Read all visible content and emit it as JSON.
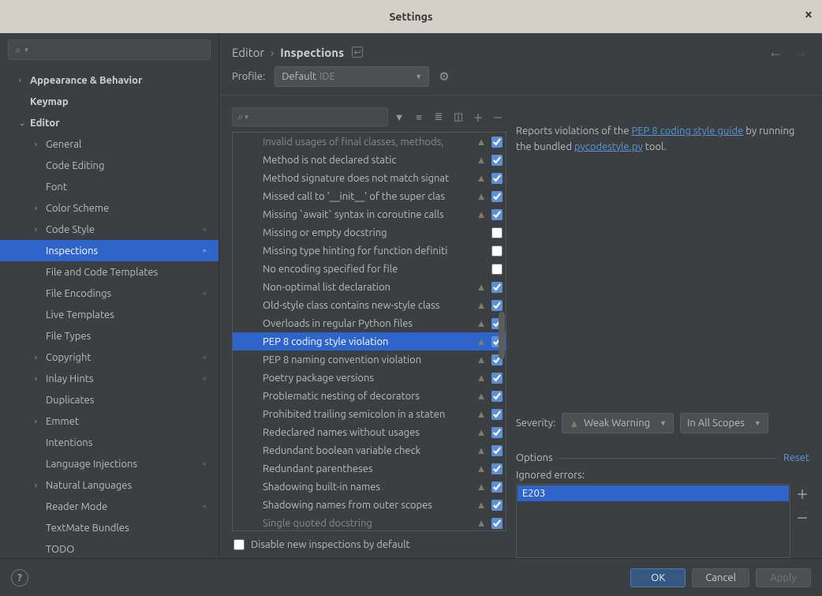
{
  "window": {
    "title": "Settings"
  },
  "breadcrumb": {
    "parent": "Editor",
    "current": "Inspections"
  },
  "profile": {
    "label": "Profile:",
    "name": "Default",
    "scope": "IDE"
  },
  "sidebar": {
    "items": [
      {
        "label": "Appearance & Behavior",
        "depth": 1,
        "chev": ">",
        "bold": true
      },
      {
        "label": "Keymap",
        "depth": 1,
        "chev": "",
        "bold": true
      },
      {
        "label": "Editor",
        "depth": 1,
        "chev": "v",
        "bold": true
      },
      {
        "label": "General",
        "depth": 2,
        "chev": ">"
      },
      {
        "label": "Code Editing",
        "depth": 2,
        "chev": ""
      },
      {
        "label": "Font",
        "depth": 2,
        "chev": ""
      },
      {
        "label": "Color Scheme",
        "depth": 2,
        "chev": ">"
      },
      {
        "label": "Code Style",
        "depth": 2,
        "chev": ">",
        "badge": "▫"
      },
      {
        "label": "Inspections",
        "depth": 2,
        "chev": "",
        "selected": true,
        "badge": "▫"
      },
      {
        "label": "File and Code Templates",
        "depth": 2,
        "chev": ""
      },
      {
        "label": "File Encodings",
        "depth": 2,
        "chev": "",
        "badge": "▫"
      },
      {
        "label": "Live Templates",
        "depth": 2,
        "chev": ""
      },
      {
        "label": "File Types",
        "depth": 2,
        "chev": ""
      },
      {
        "label": "Copyright",
        "depth": 2,
        "chev": ">",
        "badge": "▫"
      },
      {
        "label": "Inlay Hints",
        "depth": 2,
        "chev": ">",
        "badge": "▫"
      },
      {
        "label": "Duplicates",
        "depth": 2,
        "chev": ""
      },
      {
        "label": "Emmet",
        "depth": 2,
        "chev": ">"
      },
      {
        "label": "Intentions",
        "depth": 2,
        "chev": ""
      },
      {
        "label": "Language Injections",
        "depth": 2,
        "chev": "",
        "badge": "▫"
      },
      {
        "label": "Natural Languages",
        "depth": 2,
        "chev": ">"
      },
      {
        "label": "Reader Mode",
        "depth": 2,
        "chev": "",
        "badge": "▫"
      },
      {
        "label": "TextMate Bundles",
        "depth": 2,
        "chev": ""
      },
      {
        "label": "TODO",
        "depth": 2,
        "chev": ""
      }
    ]
  },
  "inspections": [
    {
      "label": "Invalid usages of final classes, methods, ",
      "warn": true,
      "checked": true,
      "dim": true
    },
    {
      "label": "Method is not declared static",
      "warn": true,
      "checked": true
    },
    {
      "label": "Method signature does not match signat",
      "warn": true,
      "checked": true
    },
    {
      "label": "Missed call to '__init__' of the super clas",
      "warn": true,
      "checked": true
    },
    {
      "label": "Missing `await` syntax in coroutine calls",
      "warn": true,
      "checked": true
    },
    {
      "label": "Missing or empty docstring",
      "warn": false,
      "checked": false
    },
    {
      "label": "Missing type hinting for function definiti",
      "warn": false,
      "checked": false
    },
    {
      "label": "No encoding specified for file",
      "warn": false,
      "checked": false
    },
    {
      "label": "Non-optimal list declaration",
      "warn": true,
      "checked": true
    },
    {
      "label": "Old-style class contains new-style class",
      "warn": true,
      "checked": true
    },
    {
      "label": "Overloads in regular Python files",
      "warn": true,
      "checked": true
    },
    {
      "label": "PEP 8 coding style violation",
      "warn": true,
      "checked": true,
      "selected": true
    },
    {
      "label": "PEP 8 naming convention violation",
      "warn": true,
      "checked": true
    },
    {
      "label": "Poetry package versions",
      "warn": true,
      "checked": true
    },
    {
      "label": "Problematic nesting of decorators",
      "warn": true,
      "checked": true
    },
    {
      "label": "Prohibited trailing semicolon in a staten",
      "warn": true,
      "checked": true
    },
    {
      "label": "Redeclared names without usages",
      "warn": true,
      "checked": true
    },
    {
      "label": "Redundant boolean variable check",
      "warn": true,
      "checked": true
    },
    {
      "label": "Redundant parentheses",
      "warn": true,
      "checked": true
    },
    {
      "label": "Shadowing built-in names",
      "warn": true,
      "checked": true
    },
    {
      "label": "Shadowing names from outer scopes",
      "warn": true,
      "checked": true
    },
    {
      "label": "Single quoted docstring",
      "warn": true,
      "checked": true,
      "dim": true
    }
  ],
  "disable_new": {
    "label": "Disable new inspections by default",
    "checked": false
  },
  "description": {
    "pre": "Reports violations of the ",
    "link1": "PEP 8 coding style guide",
    "mid": " by running the bundled ",
    "link2": "pycodestyle.py",
    "post": " tool."
  },
  "severity": {
    "label": "Severity:",
    "value": "Weak Warning",
    "scope": "In All Scopes"
  },
  "options": {
    "header": "Options",
    "reset": "Reset",
    "ignored_label": "Ignored errors:",
    "ignored_errors": [
      "E203"
    ]
  },
  "footer": {
    "ok": "OK",
    "cancel": "Cancel",
    "apply": "Apply"
  }
}
